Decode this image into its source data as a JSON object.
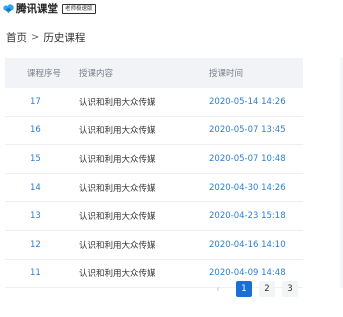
{
  "brand": {
    "name": "腾讯课堂",
    "badge": "老师极速版",
    "accent": "#1a6fd4",
    "icon": "cloud-logo-icon"
  },
  "breadcrumb": {
    "home": "首页",
    "separator": ">",
    "current": "历史课程"
  },
  "table": {
    "headers": {
      "no": "课程序号",
      "name": "授课内容",
      "time": "授课时间"
    },
    "rows": [
      {
        "no": "17",
        "name": "认识和利用大众传媒",
        "time": "2020-05-14 14:26"
      },
      {
        "no": "16",
        "name": "认识和利用大众传媒",
        "time": "2020-05-07 13:45"
      },
      {
        "no": "15",
        "name": "认识和利用大众传媒",
        "time": "2020-05-07 10:48"
      },
      {
        "no": "14",
        "name": "认识和利用大众传媒",
        "time": "2020-04-30 14:26"
      },
      {
        "no": "13",
        "name": "认识和利用大众传媒",
        "time": "2020-04-23 15:18"
      },
      {
        "no": "12",
        "name": "认识和利用大众传媒",
        "time": "2020-04-16 14:10"
      },
      {
        "no": "11",
        "name": "认识和利用大众传媒",
        "time": "2020-04-09 14:48"
      }
    ]
  },
  "pagination": {
    "prev": "‹",
    "pages": [
      "1",
      "2",
      "3"
    ],
    "current": "1"
  }
}
